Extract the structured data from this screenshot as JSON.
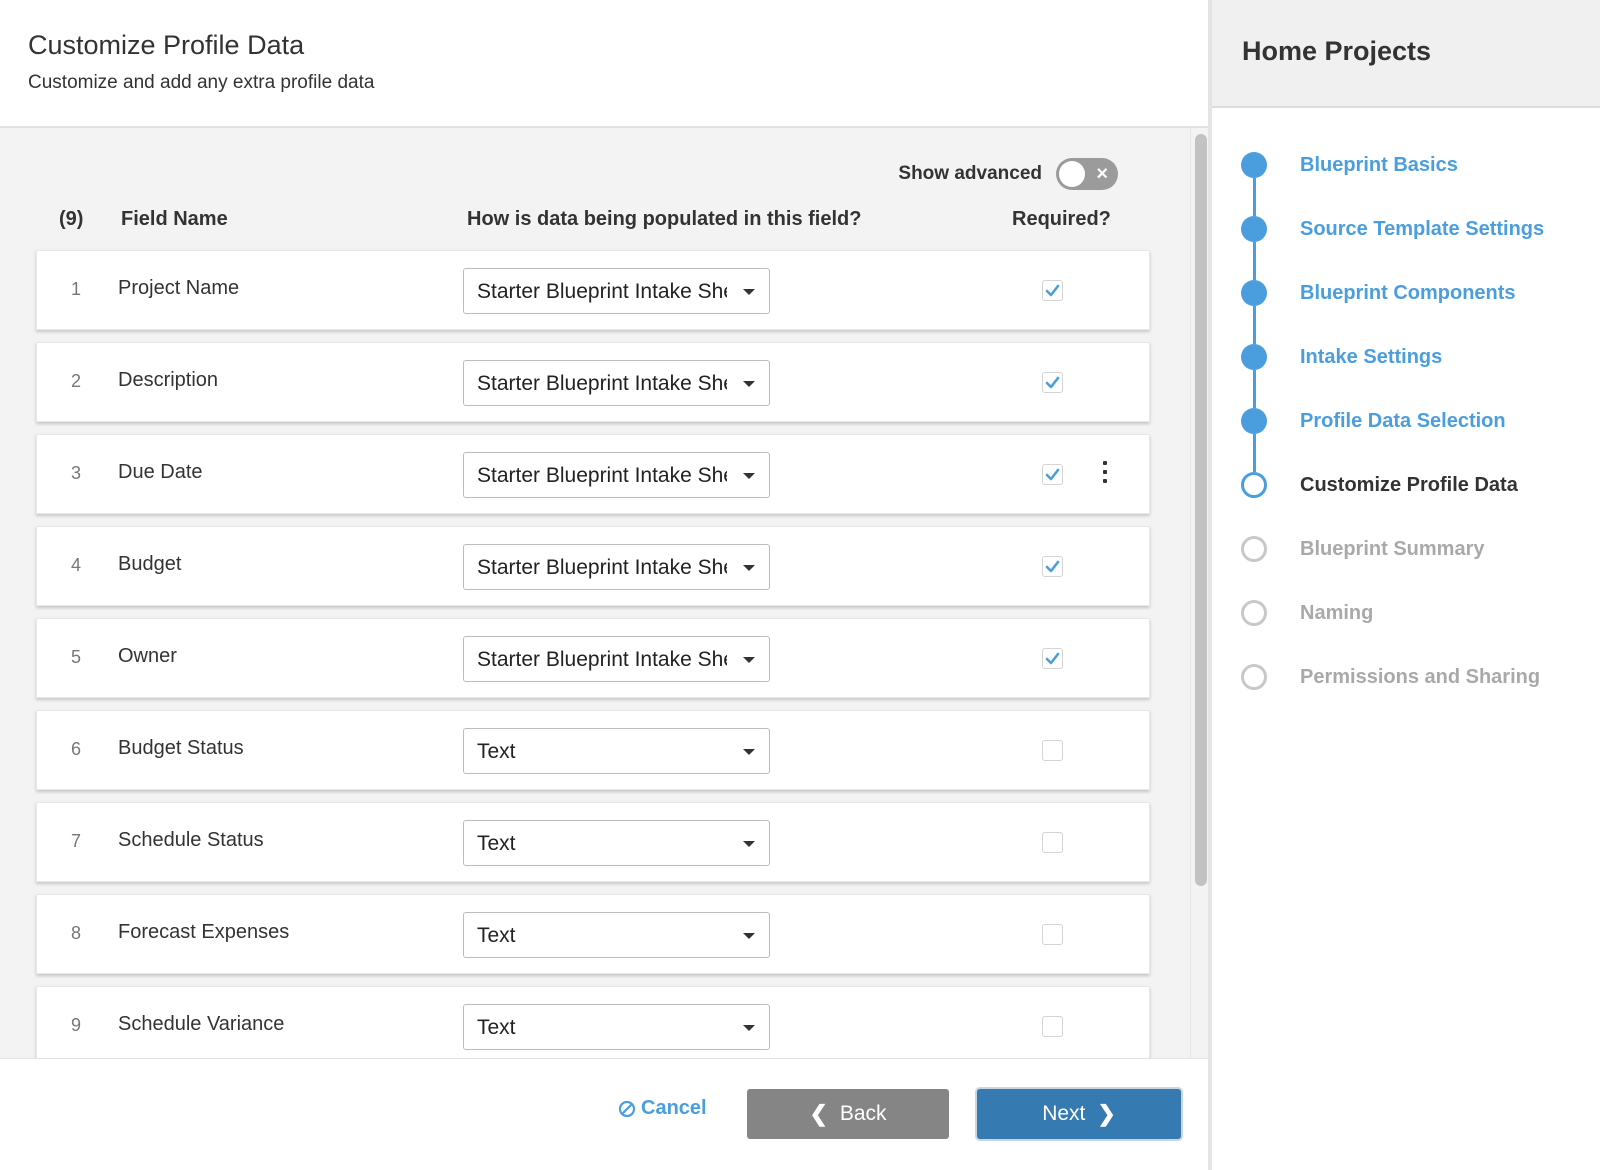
{
  "header": {
    "title": "Customize Profile Data",
    "subtitle": "Customize and add any extra profile data"
  },
  "advanced": {
    "label": "Show advanced",
    "enabled": false,
    "toggle_icon": "close-icon"
  },
  "table": {
    "count": "(9)",
    "columns": {
      "field_name": "Field Name",
      "population": "How is data being populated in this field?",
      "required": "Required?"
    },
    "rows": [
      {
        "num": "1",
        "name": "Project Name",
        "source": "Starter Blueprint Intake Sheet",
        "required": true,
        "menu": false
      },
      {
        "num": "2",
        "name": "Description",
        "source": "Starter Blueprint Intake Sheet",
        "required": true,
        "menu": false
      },
      {
        "num": "3",
        "name": "Due Date",
        "source": "Starter Blueprint Intake Sheet",
        "required": true,
        "menu": true
      },
      {
        "num": "4",
        "name": "Budget",
        "source": "Starter Blueprint Intake Sheet",
        "required": true,
        "menu": false
      },
      {
        "num": "5",
        "name": "Owner",
        "source": "Starter Blueprint Intake Sheet",
        "required": true,
        "menu": false
      },
      {
        "num": "6",
        "name": "Budget Status",
        "source": "Text",
        "required": false,
        "menu": false
      },
      {
        "num": "7",
        "name": "Schedule Status",
        "source": "Text",
        "required": false,
        "menu": false
      },
      {
        "num": "8",
        "name": "Forecast Expenses",
        "source": "Text",
        "required": false,
        "menu": false
      },
      {
        "num": "9",
        "name": "Schedule Variance",
        "source": "Text",
        "required": false,
        "menu": false
      }
    ]
  },
  "footer": {
    "cancel_label": "Cancel",
    "back_label": "Back",
    "next_label": "Next"
  },
  "sidebar": {
    "title": "Home Projects",
    "steps": [
      {
        "label": "Blueprint Basics",
        "state": "done"
      },
      {
        "label": "Source Template Settings",
        "state": "done"
      },
      {
        "label": "Blueprint Components",
        "state": "done"
      },
      {
        "label": "Intake Settings",
        "state": "done"
      },
      {
        "label": "Profile Data Selection",
        "state": "done"
      },
      {
        "label": "Customize Profile Data",
        "state": "current"
      },
      {
        "label": "Blueprint Summary",
        "state": "todo"
      },
      {
        "label": "Naming",
        "state": "todo"
      },
      {
        "label": "Permissions and Sharing",
        "state": "todo"
      }
    ]
  },
  "colors": {
    "accent": "#4a9ede",
    "primary_button": "#357ab0",
    "secondary_button": "#858585",
    "inactive": "#a9a9a9"
  }
}
